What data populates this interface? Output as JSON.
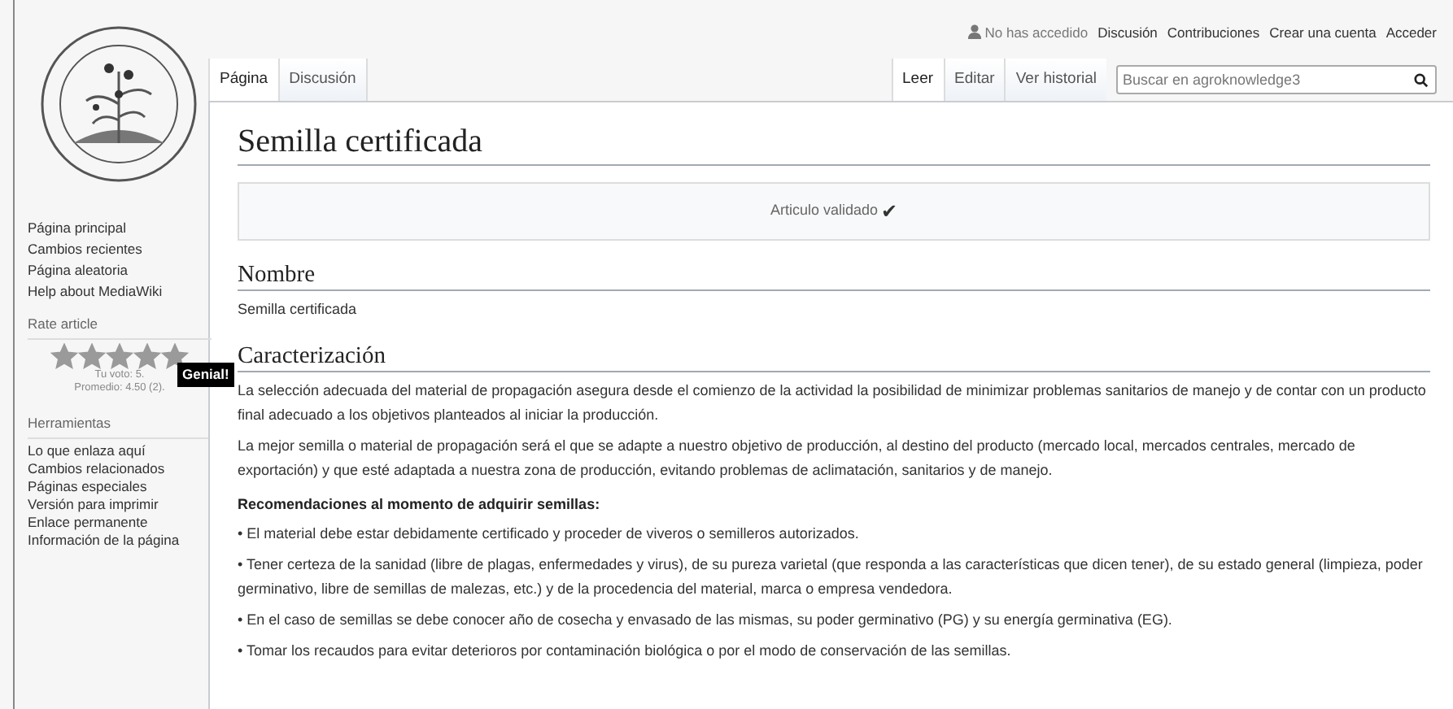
{
  "personal": {
    "status": "No has accedido",
    "links": [
      "Discusión",
      "Contribuciones",
      "Crear una cuenta",
      "Acceder"
    ]
  },
  "left_tabs": [
    {
      "label": "Página",
      "selected": true
    },
    {
      "label": "Discusión",
      "selected": false
    }
  ],
  "right_tabs": [
    {
      "label": "Leer",
      "selected": true
    },
    {
      "label": "Editar",
      "selected": false
    },
    {
      "label": "Ver historial",
      "selected": false
    }
  ],
  "search": {
    "placeholder": "Buscar en agroknowledge3"
  },
  "sidebar": {
    "nav": [
      "Página principal",
      "Cambios recientes",
      "Página aleatoria",
      "Help about MediaWiki"
    ],
    "rating": {
      "heading": "Rate article",
      "stars": 5,
      "vote": "Tu voto: 5.",
      "average": "Promedio: 4.50 (2).",
      "tooltip": "Genial!"
    },
    "tools_heading": "Herramientas",
    "tools": [
      "Lo que enlaza aquí",
      "Cambios relacionados",
      "Páginas especiales",
      "Versión para imprimir",
      "Enlace permanente",
      "Información de la página"
    ]
  },
  "page": {
    "title": "Semilla certificada",
    "notice": "Articulo validado",
    "check": "✔",
    "sections": [
      {
        "heading": "Nombre",
        "blocks": [
          {
            "kind": "para",
            "text": "Semilla certificada"
          }
        ]
      },
      {
        "heading": "Caracterización",
        "blocks": [
          {
            "kind": "para",
            "text": "La selección adecuada del material de propagación asegura desde el comienzo de la actividad la posibilidad de minimizar problemas sanitarios de manejo y de contar con un producto final adecuado a los objetivos planteados al iniciar la producción."
          },
          {
            "kind": "para",
            "text": "La mejor semilla o material de propagación será el que se adapte a nuestro objetivo de producción, al destino del producto (mercado local, mercados centrales, mercado de exportación) y que esté adaptada a nuestra zona de producción, evitando problemas de aclimatación, sanitarios y de manejo."
          },
          {
            "kind": "bold",
            "text": "Recomendaciones al momento de adquirir semillas:"
          },
          {
            "kind": "para",
            "text": "• El material debe estar debidamente certificado y proceder de viveros o semilleros autorizados."
          },
          {
            "kind": "para",
            "text": "• Tener certeza de la sanidad (libre de plagas, enfermedades y virus), de su pureza varietal (que responda a las características que dicen tener), de su estado general (limpieza, poder germinativo, libre de semillas de malezas, etc.) y de la procedencia del material, marca o empresa vendedora."
          },
          {
            "kind": "para",
            "text": "• En el caso de semillas se debe conocer año de cosecha y envasado de las mismas, su poder germinativo (PG) y su energía germinativa (EG)."
          },
          {
            "kind": "para",
            "text": "• Tomar los recaudos para evitar deterioros por contaminación biológica o por el modo de conservación de las semillas."
          }
        ]
      }
    ]
  }
}
